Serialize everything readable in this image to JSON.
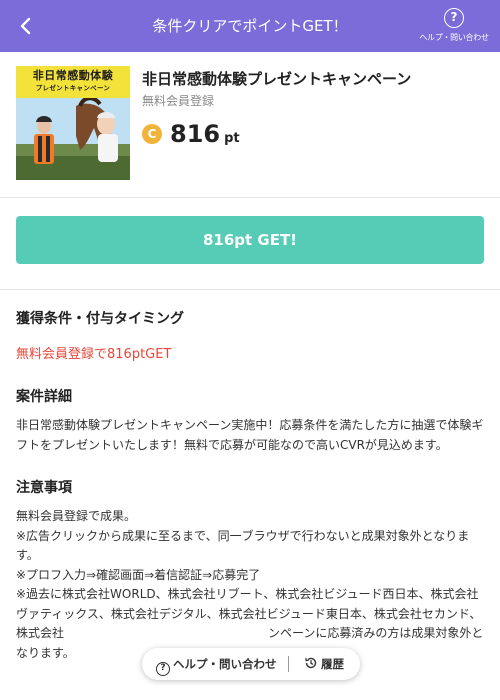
{
  "header": {
    "back_icon": "chevron-left-icon",
    "title": "条件クリアでポイントGET！",
    "help_icon": "question-circle-icon",
    "help_label": "ヘルプ・問い合わせ",
    "bg_color": "#7b6cd9"
  },
  "offer": {
    "image_banner_line1": "非日常感動体験",
    "image_banner_line2": "プレゼントキャンペーン",
    "title": "非日常感動体験プレゼントキャンペーン",
    "subtitle": "無料会員登録",
    "coin_symbol": "C",
    "points": "816",
    "points_unit": "pt"
  },
  "get_button": {
    "label": "816pt GET!",
    "color": "#56cbb6"
  },
  "sections": {
    "condition_heading": "獲得条件・付与タイミング",
    "condition_text": "無料会員登録で816ptGET",
    "detail_heading": "案件詳細",
    "detail_text": "非日常感動体験プレゼントキャンペーン実施中！応募条件を満たした方に抽選で体験ギフトをプレゼントいたします！無料で応募が可能なので高いCVRが見込めます。",
    "notes_heading": "注意事項",
    "notes_lines": [
      "無料会員登録で成果。",
      "※広告クリックから成果に至るまで、同一ブラウザで行わないと成果対象外となります。",
      "※プロフ入力⇒確認画面⇒着信認証⇒応募完了",
      "※過去に株式会社WORLD、株式会社リブート、株式会社ビジュード西日本、株式会社ヴァティックス、株式会社デジタル、株式会社ビジュード東日本、株式会社セカンド、株式会社　　　　　　　　　　　　　　　　　ンペーンに応募済みの方は成果対象外となります。"
    ]
  },
  "floating_bar": {
    "help_icon": "question-circle-icon",
    "help_label": "ヘルプ・問い合わせ",
    "history_icon": "history-icon",
    "history_label": "履歴"
  }
}
